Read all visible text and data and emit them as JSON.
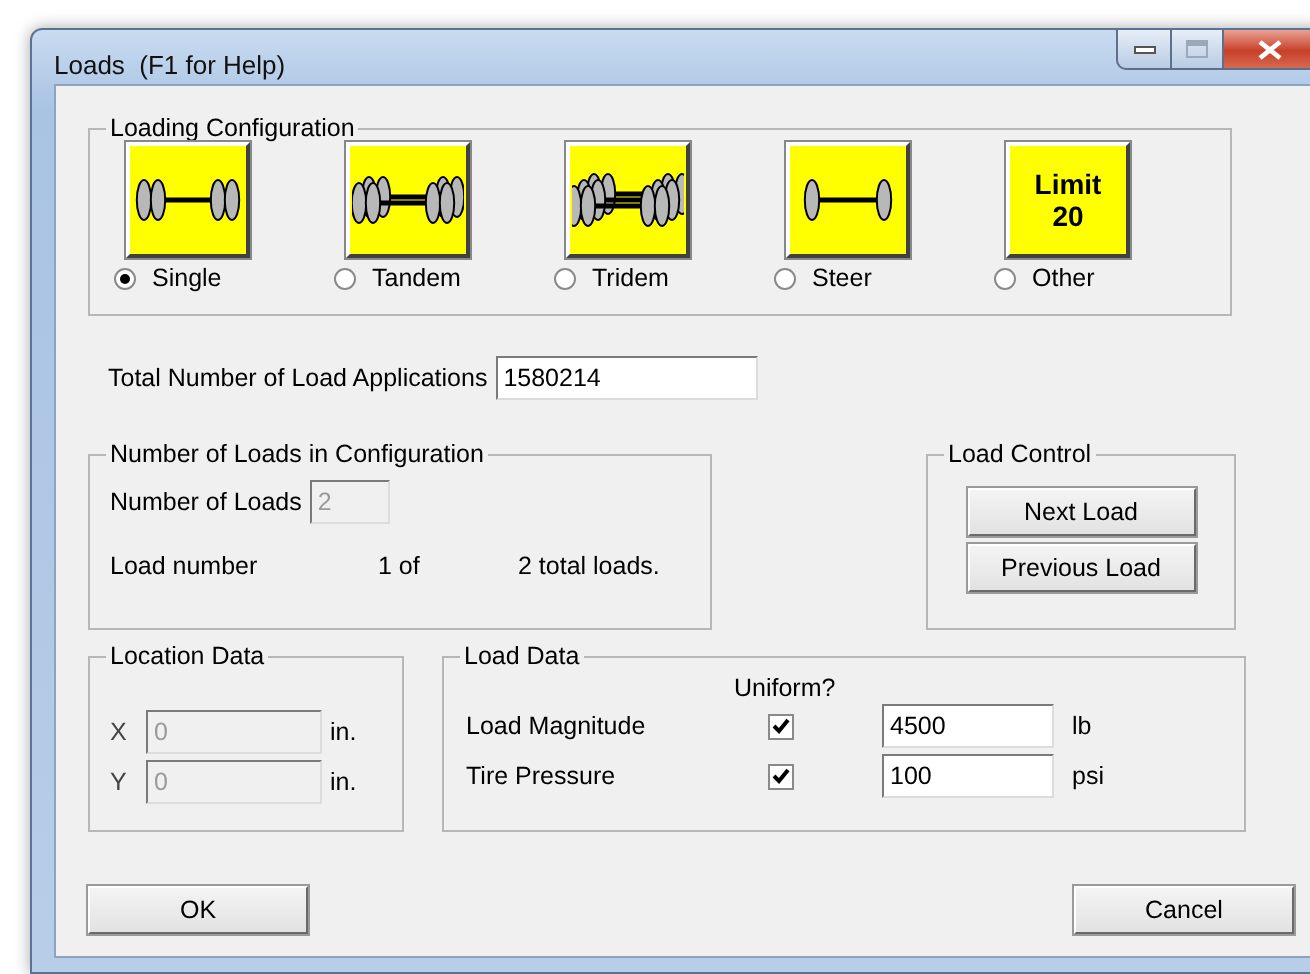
{
  "window": {
    "title": "Loads  (F1 for Help)"
  },
  "loading_configuration": {
    "title": "Loading Configuration",
    "options": [
      {
        "kind": "single",
        "label": "Single",
        "selected": true
      },
      {
        "kind": "tandem",
        "label": "Tandem",
        "selected": false
      },
      {
        "kind": "tridem",
        "label": "Tridem",
        "selected": false
      },
      {
        "kind": "steer",
        "label": "Steer",
        "selected": false
      },
      {
        "kind": "limit",
        "icon_text": [
          "Limit",
          "20"
        ],
        "label": "Other",
        "selected": false
      }
    ]
  },
  "total_applications": {
    "label": "Total Number of Load Applications",
    "value": "1580214"
  },
  "loads_in_configuration": {
    "title": "Number of Loads in Configuration",
    "count_label": "Number of Loads",
    "count_value": "2",
    "count_disabled": true,
    "load_number_label": "Load number",
    "position": "1 of",
    "total": "2 total loads."
  },
  "load_control": {
    "title": "Load Control",
    "buttons": [
      "Next Load",
      "Previous Load"
    ]
  },
  "location_data": {
    "title": "Location Data",
    "rows": [
      {
        "axis": "X",
        "value": "0",
        "unit": "in.",
        "disabled": true
      },
      {
        "axis": "Y",
        "value": "0",
        "unit": "in.",
        "disabled": true
      }
    ]
  },
  "load_data": {
    "title": "Load Data",
    "uniform_header": "Uniform?",
    "rows": [
      {
        "label": "Load Magnitude",
        "uniform": true,
        "value": "4500",
        "unit": "lb"
      },
      {
        "label": "Tire Pressure",
        "uniform": true,
        "value": "100",
        "unit": "psi"
      }
    ]
  },
  "buttons": [
    "OK",
    "Cancel"
  ]
}
